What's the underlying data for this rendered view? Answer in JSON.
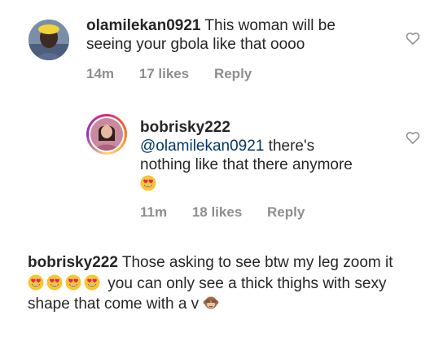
{
  "comments": [
    {
      "username": "olamilekan0921",
      "text_line1": "This woman will be",
      "text_line2": "seeing your gbola like that oooo",
      "time": "14m",
      "likes": "17 likes",
      "reply": "Reply",
      "avatar": "person-photo"
    },
    {
      "username": "bobrisky222",
      "mention": "@olamilekan0921",
      "text_line1_rest": " there's",
      "text_line2": "nothing like that there anymore",
      "emoji": "heart-eyes-emoji",
      "time": "11m",
      "likes": "18 likes",
      "reply": "Reply",
      "avatar": "person-photo-story-ring"
    }
  ],
  "caption": {
    "username": "bobrisky222",
    "line1": "Those asking to see btw my leg zoom it",
    "line2": "you can only see a thick thighs with sexy",
    "line3": "shape that come with a v",
    "emojis": [
      "heart-eyes-emoji",
      "heart-eyes-emoji",
      "heart-eyes-emoji",
      "heart-eyes-emoji"
    ],
    "end_emoji": "see-no-evil-monkey-emoji"
  },
  "icons": {
    "like": "heart-outline-icon"
  }
}
